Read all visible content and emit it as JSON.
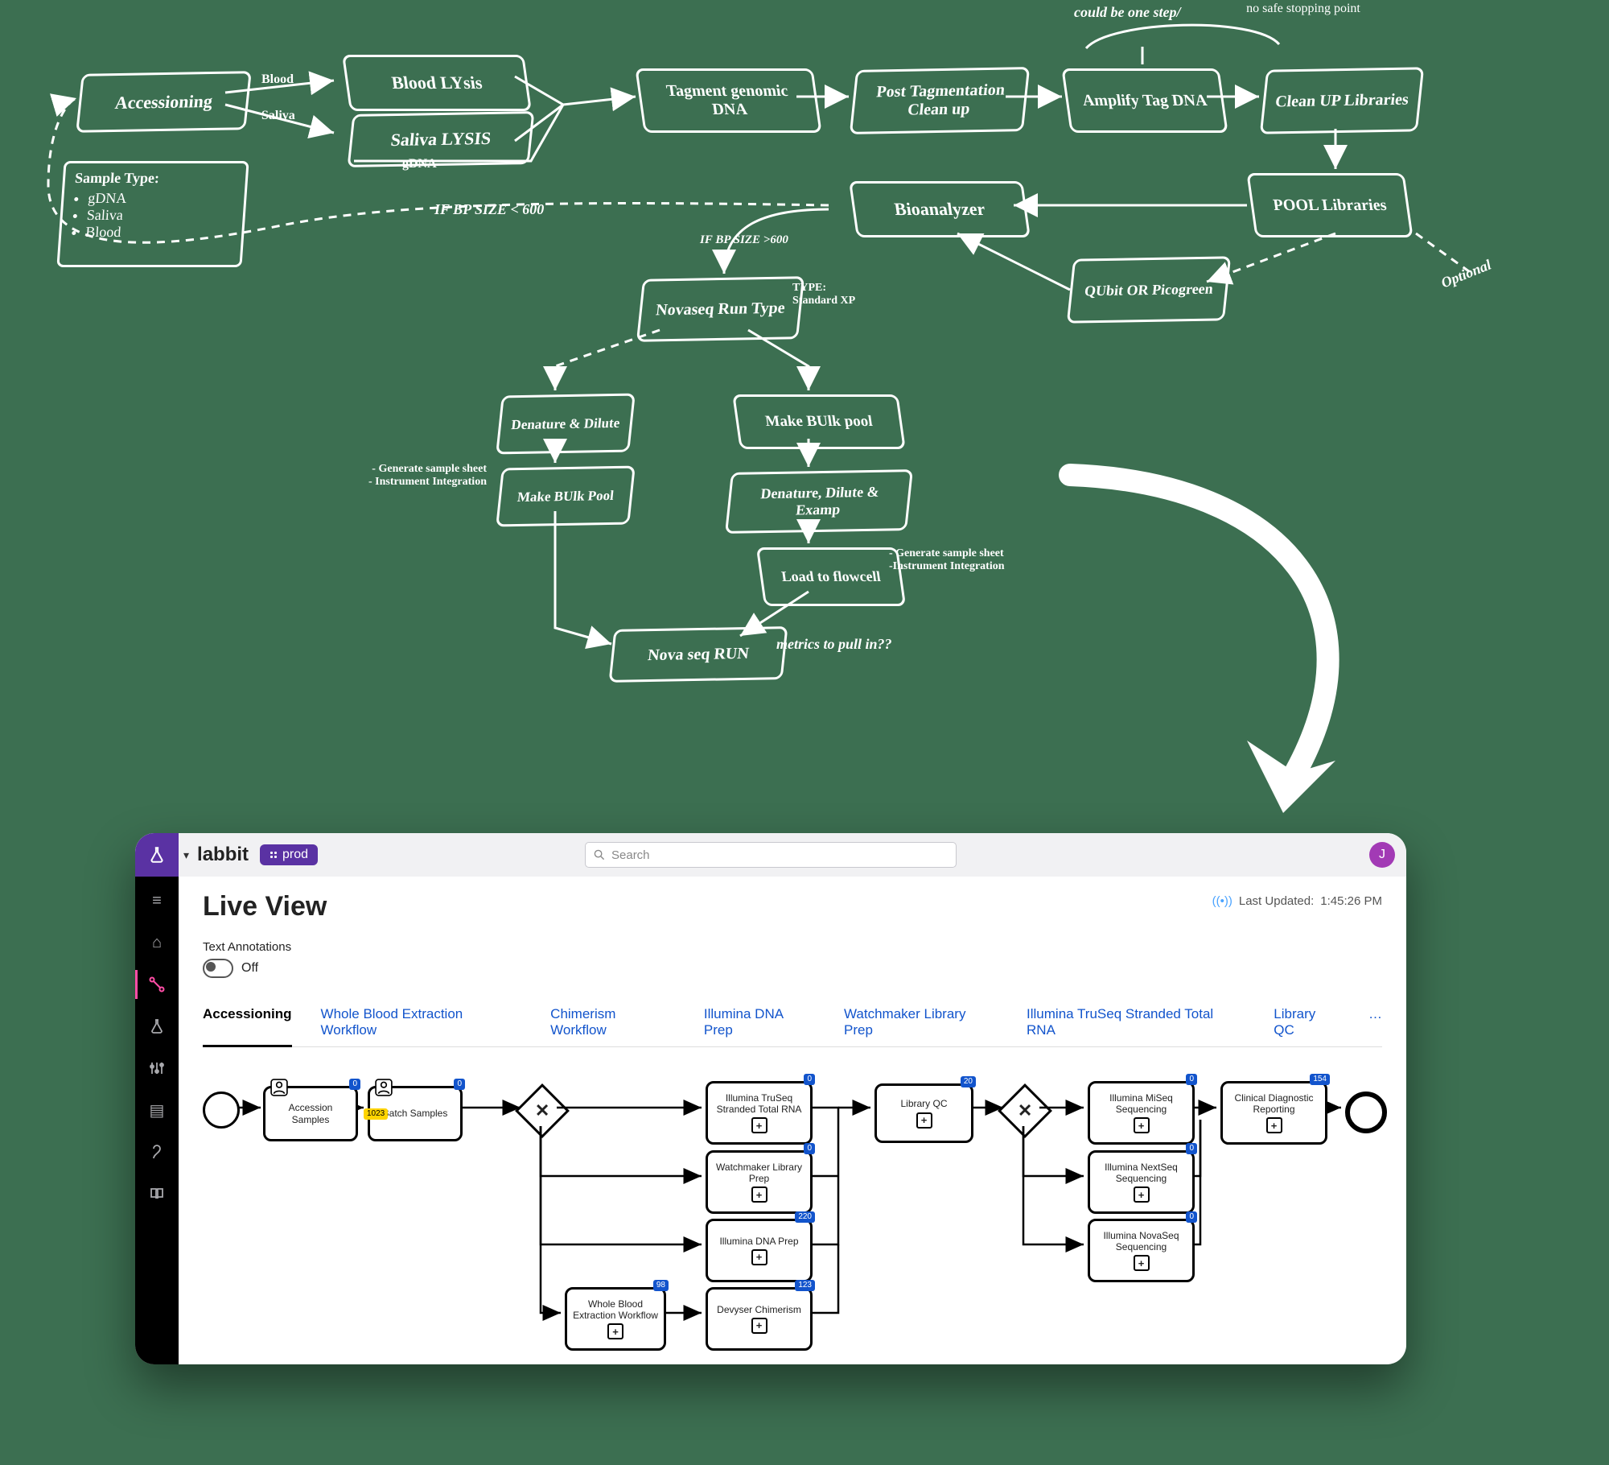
{
  "whiteboard": {
    "nodes": {
      "accessioning": "Accessioning",
      "bloodLysis": "Blood LYsis",
      "salivaLysis": "Saliva LYSIS",
      "tagment": "Tagment genomic DNA",
      "postTag": "Post Tagmentation Clean up",
      "amplify": "Amplify Tag DNA",
      "cleanup": "Clean UP Libraries",
      "pool": "POOL Libraries",
      "qubit": "QUbit OR Picogreen",
      "bio": "Bioanalyzer",
      "novaseqType": "Novaseq Run Type",
      "denDil": "Denature & Dilute",
      "makeBulk": "Make BUlk Pool",
      "makeBulk2": "Make BUlk pool",
      "dde": "Denature, Dilute & Examp",
      "load": "Load to flowcell",
      "run": "Nova seq RUN"
    },
    "notes": {
      "sampleTitle": "Sample Type:",
      "s1": "gDNA",
      "s2": "Saliva",
      "s3": "Blood",
      "blood": "Blood",
      "saliva": "Saliva",
      "gdna": "gDNA",
      "ifsize": "IF BP SIZE < 600",
      "ifsize2": "IF BP SIZE >600",
      "oneStep": "could be one step/",
      "nosafe": "no  safe stopping point",
      "typeStd": "TYPE: Standard XP",
      "gen1a": "Generate sample sheet",
      "gen1b": "Instrument Integration",
      "gen2a": "- Generate sample sheet",
      "gen2b": "-Instrument Integration",
      "optional": "Optional",
      "metrics": "metrics to pull in??"
    }
  },
  "app": {
    "brand": "labbit",
    "env": "prod",
    "searchPlaceholder": "Search",
    "avatar": "J",
    "title": "Live View",
    "updatedLabel": "Last Updated:",
    "updatedTime": "1:45:26 PM",
    "annoLabel": "Text Annotations",
    "toggleState": "Off",
    "tabs": [
      "Accessioning",
      "Whole Blood Extraction Workflow",
      "Chimerism Workflow",
      "Illumina DNA Prep",
      "Watchmaker Library Prep",
      "Illumina TruSeq Stranded Total RNA",
      "Library QC",
      "…"
    ],
    "bpmn": {
      "accSamples": "Accession Samples",
      "batchSamples": "Batch Samples",
      "truseq": "Illumina TruSeq Stranded Total RNA",
      "watch": "Watchmaker Library Prep",
      "dnaPrep": "Illumina DNA Prep",
      "wholeBlood": "Whole Blood Extraction Workflow",
      "devyser": "Devyser Chimerism",
      "libqc": "Library QC",
      "miseq": "Illumina MiSeq Sequencing",
      "nextseq": "Illumina NextSeq Sequencing",
      "novaseq": "Illumina NovaSeq Sequencing",
      "reporting": "Clinical Diagnostic Reporting",
      "badges": {
        "acc": "0",
        "batch": "0",
        "batchAlt": "1023",
        "truseq": "0",
        "watch": "0",
        "dnaPrep": "220",
        "wholeBlood": "98",
        "devyser": "123",
        "libqc": "20",
        "miseq": "0",
        "nextseq": "0",
        "novaseq": "0",
        "reporting": "154"
      }
    }
  }
}
